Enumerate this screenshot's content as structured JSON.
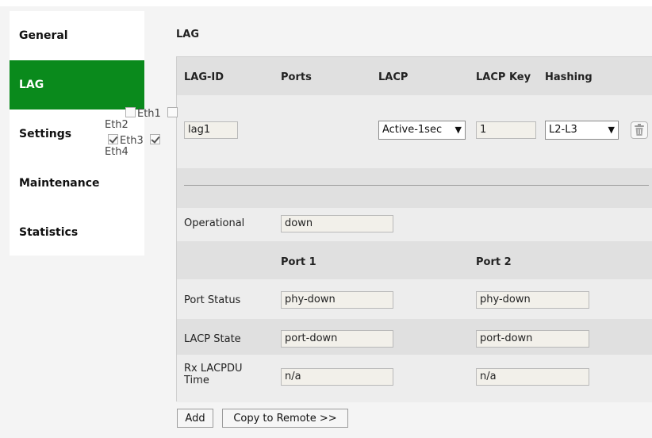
{
  "sidebar": {
    "items": [
      {
        "label": "General"
      },
      {
        "label": "LAG"
      },
      {
        "label": "Settings"
      },
      {
        "label": "Maintenance"
      },
      {
        "label": "Statistics"
      }
    ]
  },
  "section_title": "LAG",
  "table": {
    "headers": {
      "lag_id": "LAG-ID",
      "ports": "Ports",
      "lacp": "LACP",
      "lacp_key": "LACP Key",
      "hashing": "Hashing"
    },
    "row": {
      "lag_id": "lag1",
      "ports": [
        {
          "label": "Eth1",
          "checked": false
        },
        {
          "label": "Eth2",
          "checked": false
        },
        {
          "label": "Eth3",
          "checked": true
        },
        {
          "label": "Eth4",
          "checked": true
        }
      ],
      "lacp": "Active-1sec",
      "lacp_key": "1",
      "hashing": "L2-L3"
    }
  },
  "operational": {
    "label": "Operational",
    "value": "down"
  },
  "port_cols": {
    "port1": "Port 1",
    "port2": "Port 2"
  },
  "status_rows": {
    "port_status": {
      "label": "Port Status",
      "port1": "phy-down",
      "port2": "phy-down"
    },
    "lacp_state": {
      "label": "LACP State",
      "port1": "port-down",
      "port2": "port-down"
    },
    "rx_lacpdu": {
      "label_line1": "Rx LACPDU",
      "label_line2": "Time",
      "port1": "n/a",
      "port2": "n/a"
    }
  },
  "buttons": {
    "add": "Add",
    "copy": "Copy to Remote >>"
  }
}
